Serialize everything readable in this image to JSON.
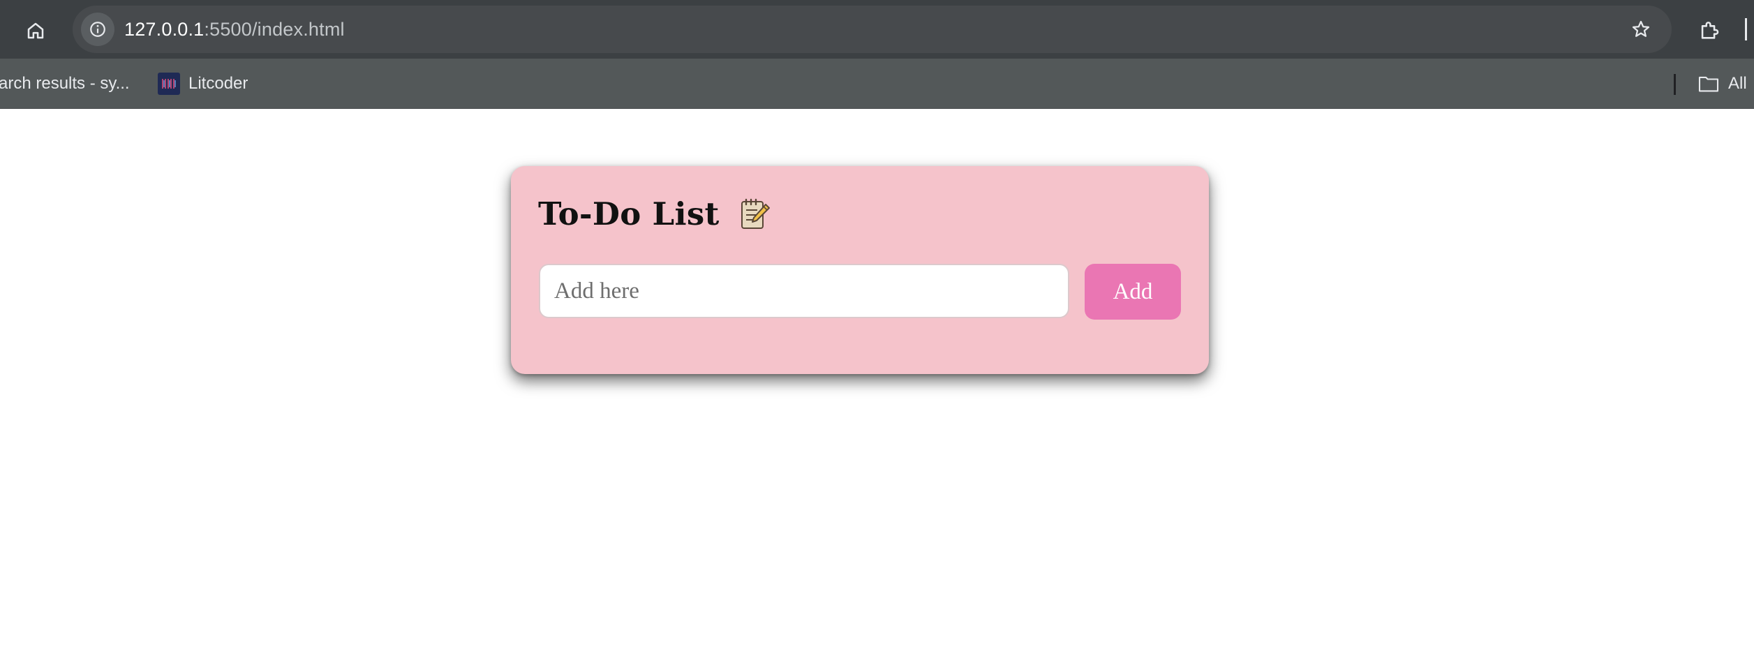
{
  "browser": {
    "url_host": "127.0.0.1",
    "url_rest": ":5500/index.html",
    "icons": {
      "home": "home-icon",
      "site_info": "info-icon",
      "bookmark_star": "star-icon",
      "extensions": "puzzle-icon"
    }
  },
  "bookmarks": {
    "items": [
      {
        "label": "arch results - sy..."
      },
      {
        "label": "Litcoder",
        "icon": "litcoder-favicon"
      }
    ],
    "all_bookmarks_label": "All"
  },
  "todo": {
    "title": "To-Do List",
    "title_icon": "notepad-icon",
    "input_placeholder": "Add here",
    "input_value": "",
    "add_button_label": "Add",
    "colors": {
      "card_background": "#f5c3cb",
      "button_background": "#ea76b3",
      "button_text": "#ffffff"
    }
  }
}
